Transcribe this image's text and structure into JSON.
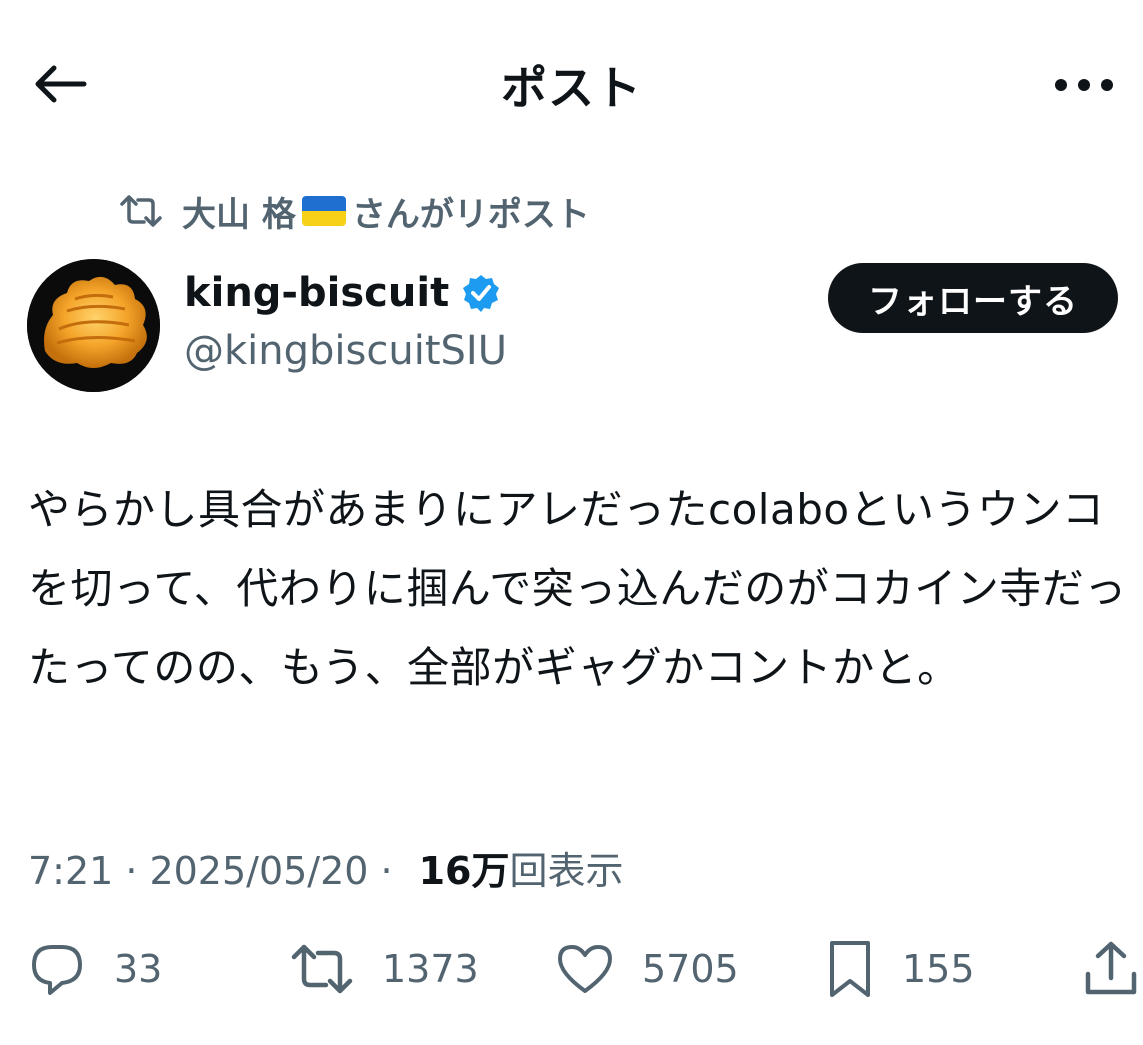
{
  "header": {
    "title": "ポスト",
    "back_icon": "arrow-left-icon",
    "more_icon": "more-horizontal-icon"
  },
  "repost": {
    "icon": "repost-icon",
    "user": "大山 格",
    "flag_colors": [
      "#1f6fd1",
      "#f7d117"
    ],
    "suffix": "さんがリポスト"
  },
  "author": {
    "display_name": "king-biscuit",
    "handle": "@kingbiscuitSIU",
    "verified_color": "#1d9bf0",
    "follow_label": "フォローする"
  },
  "post": {
    "text": "やらかし具合があまりにアレだったcolaboというウンコを切って、代わりに掴んで突っ込んだのがコカイン寺だったってのの、もう、全部がギャグかコントかと。"
  },
  "meta": {
    "time": "7:21",
    "date": "2025/05/20",
    "views_count": "16万",
    "views_label": "回表示",
    "separator": "·"
  },
  "actions": {
    "replies": "33",
    "reposts": "1373",
    "likes": "5705",
    "bookmarks": "155"
  },
  "colors": {
    "text": "#0f1419",
    "secondary": "#536471",
    "accent": "#1d9bf0"
  }
}
